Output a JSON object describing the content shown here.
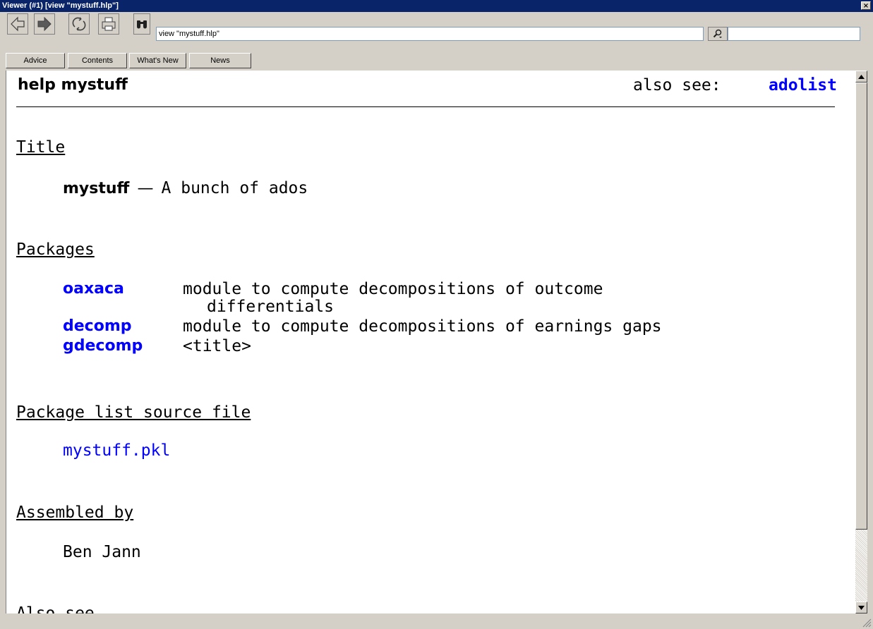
{
  "window": {
    "title": "Viewer (#1) [view \"mystuff.hlp\"]",
    "close_glyph": "×"
  },
  "toolbar": {
    "command_value": "view \"mystuff.hlp\"",
    "search_value": "",
    "icons": [
      "back-arrow-icon",
      "forward-arrow-icon",
      "refresh-icon",
      "print-icon",
      "binoculars-icon",
      "search-magnifier-icon"
    ]
  },
  "linkbar": {
    "items": [
      {
        "label": "Advice"
      },
      {
        "label": "Contents"
      },
      {
        "label": "What's New"
      },
      {
        "label": "News"
      }
    ]
  },
  "help": {
    "header_left": "help mystuff",
    "also_see_label": "also see:",
    "also_see_link": "adolist",
    "sections": {
      "title_heading": "Title",
      "title_command": "mystuff",
      "title_dash": "—",
      "title_description": "A bunch of ados",
      "packages_heading": "Packages",
      "packages": [
        {
          "name": "oaxaca",
          "line1": "module to compute decompositions of outcome",
          "line2": "differentials"
        },
        {
          "name": "decomp",
          "line1": "module to compute decompositions of earnings gaps"
        },
        {
          "name": "gdecomp",
          "line1": "<title>"
        }
      ],
      "source_heading": "Package list source file",
      "source_file": "mystuff.pkl",
      "assembled_heading": "Assembled by",
      "assembled_name": "Ben Jann",
      "also_see_heading": "Also see"
    }
  },
  "colors": {
    "link": "#0000ff",
    "titlebar": "#0a246a",
    "chrome": "#d4d0c8"
  }
}
